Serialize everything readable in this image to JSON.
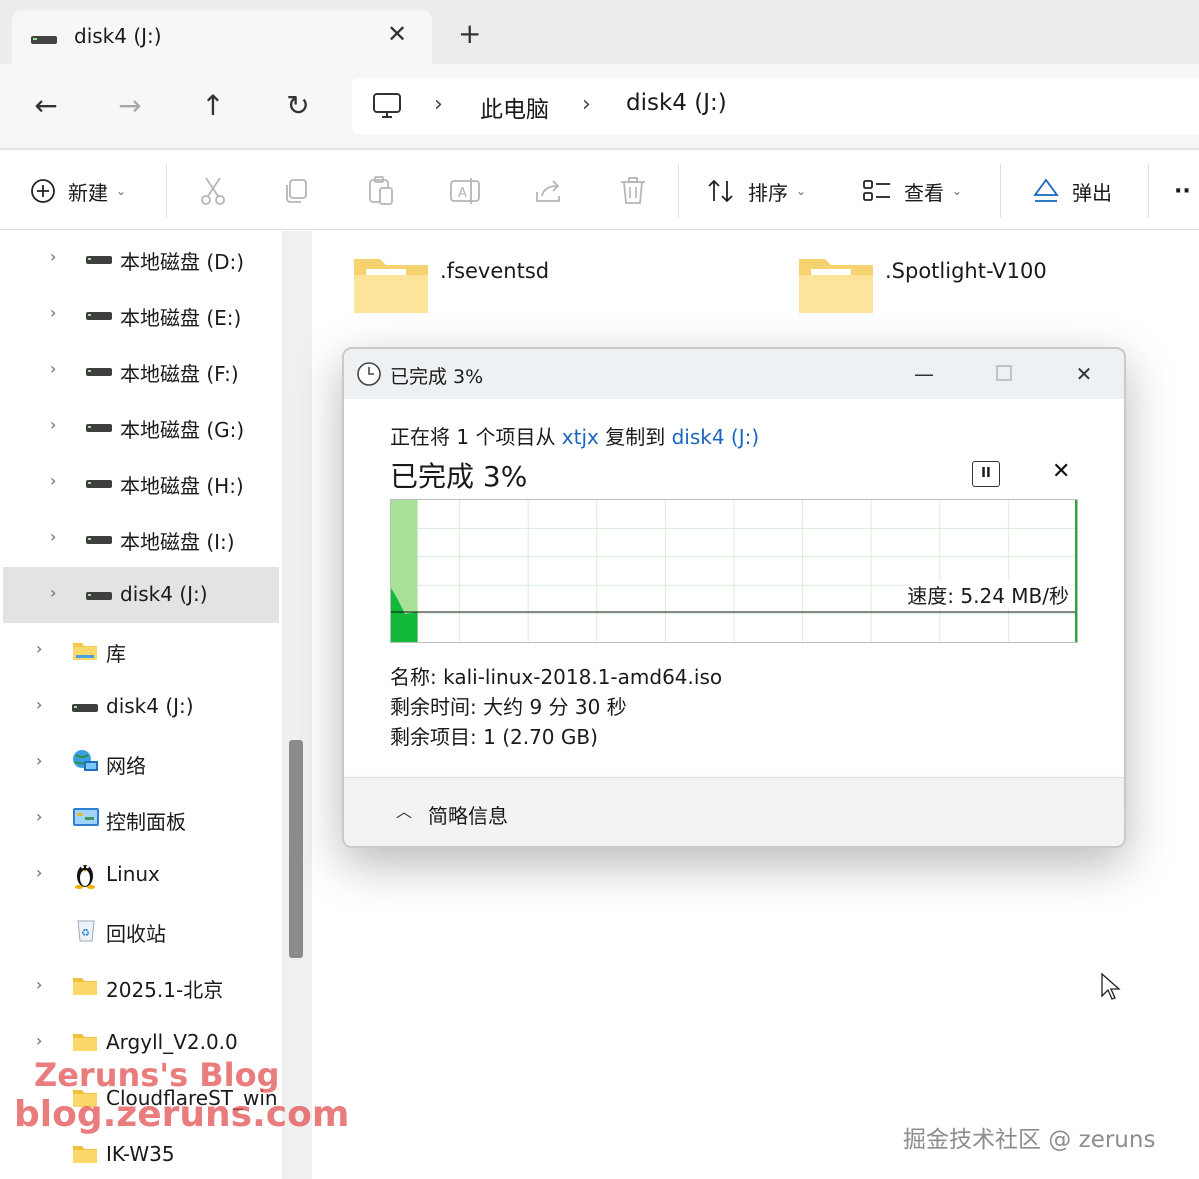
{
  "tab": {
    "title": "disk4 (J:)",
    "close": "✕",
    "add": "+"
  },
  "nav": {
    "back": "←",
    "forward": "→",
    "up": "↑",
    "refresh": "↻"
  },
  "breadcrumb": {
    "sep1": "›",
    "sep2": "›",
    "items": [
      "此电脑",
      "disk4 (J:)"
    ]
  },
  "toolbar": {
    "new_label": "新建",
    "sort_label": "排序",
    "view_label": "查看",
    "eject_label": "弹出",
    "more": "··"
  },
  "sidebar": {
    "items": [
      {
        "label": "本地磁盘 (D:)",
        "icon": "drive-icon"
      },
      {
        "label": "本地磁盘 (E:)",
        "icon": "drive-icon"
      },
      {
        "label": "本地磁盘 (F:)",
        "icon": "drive-icon"
      },
      {
        "label": "本地磁盘 (G:)",
        "icon": "drive-icon"
      },
      {
        "label": "本地磁盘 (H:)",
        "icon": "drive-icon"
      },
      {
        "label": "本地磁盘 (I:)",
        "icon": "drive-icon"
      },
      {
        "label": "disk4 (J:)",
        "icon": "drive-icon",
        "selected": true
      },
      {
        "label": "库",
        "icon": "library-folder-icon"
      },
      {
        "label": "disk4 (J:)",
        "icon": "drive-icon"
      },
      {
        "label": "网络",
        "icon": "network-icon"
      },
      {
        "label": "控制面板",
        "icon": "control-panel-icon"
      },
      {
        "label": "Linux",
        "icon": "linux-penguin-icon"
      },
      {
        "label": "回收站",
        "icon": "recycle-bin-icon"
      },
      {
        "label": "2025.1-北京",
        "icon": "folder-icon"
      },
      {
        "label": "Argyll_V2.0.0",
        "icon": "folder-icon"
      },
      {
        "label": "CloudflareST_win",
        "icon": "folder-icon"
      },
      {
        "label": "IK-W35",
        "icon": "folder-icon"
      }
    ]
  },
  "files": [
    {
      "name": ".fseventsd"
    },
    {
      "name": ".Spotlight-V100"
    }
  ],
  "dialog": {
    "title": "已完成 3%",
    "line_prefix": "正在将 1 个项目从 ",
    "source": "xtjx",
    "line_mid": " 复制到 ",
    "dest": "disk4 (J:)",
    "progress_label": "已完成 3%",
    "progress_percent": 3,
    "speed": "速度: 5.24 MB/秒",
    "name_label": "名称: ",
    "name_value": "kali-linux-2018.1-amd64.iso",
    "time_label": "剩余时间: ",
    "time_value": "大约 9 分 30 秒",
    "items_label": "剩余项目: ",
    "items_value": "1 (2.70 GB)",
    "details_toggle": "简略信息",
    "min": "—",
    "close": "✕",
    "cancel": "✕"
  },
  "watermark": {
    "line1": "Zeruns's Blog",
    "line2": "blog.zeruns.com"
  },
  "credit": "掘金技术社区 @ zeruns",
  "colors": {
    "accent": "#1a66c0",
    "graph_fill": "#12b83a",
    "graph_done": "#a8e29a",
    "selection": "#e3e3e3"
  }
}
